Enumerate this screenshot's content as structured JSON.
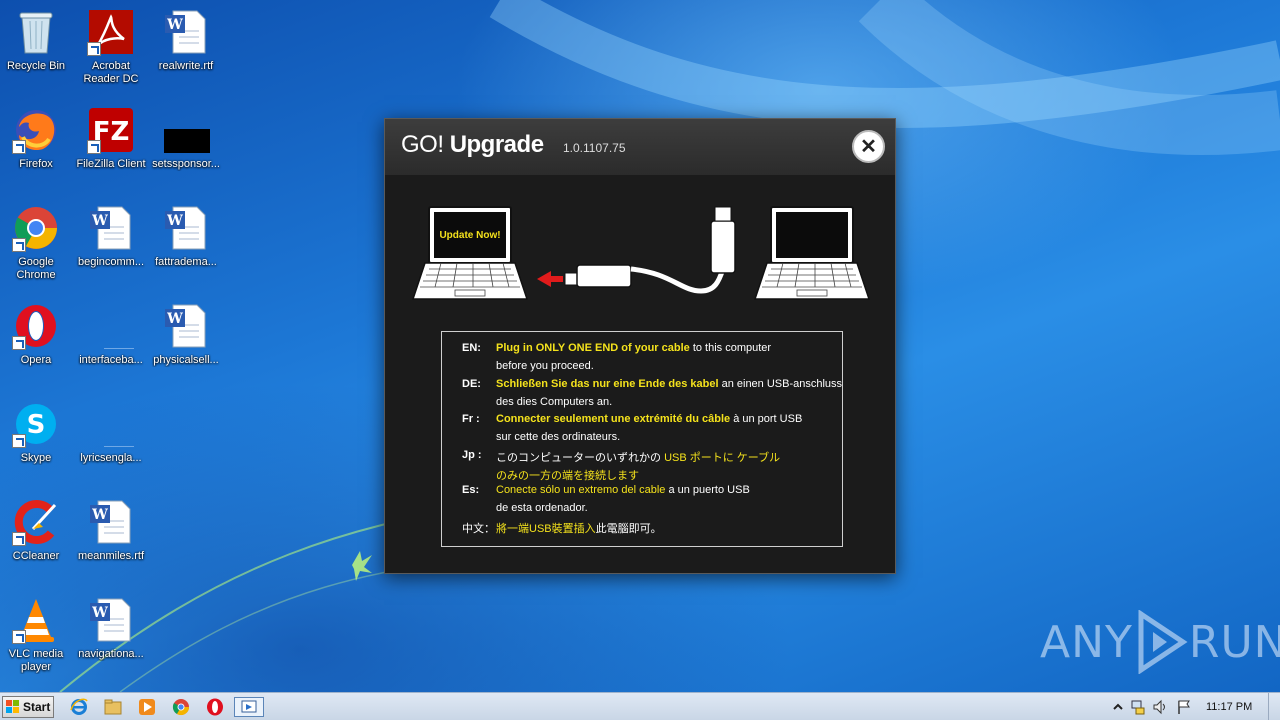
{
  "desktop": {
    "icons": [
      {
        "label": "Recycle Bin",
        "icon": "recycle-bin-icon",
        "shortcut": false
      },
      {
        "label": "Acrobat Reader DC",
        "icon": "acrobat-reader-icon",
        "shortcut": true
      },
      {
        "label": "realwrite.rtf",
        "icon": "word-document-icon",
        "shortcut": false
      },
      {
        "label": "Firefox",
        "icon": "firefox-icon",
        "shortcut": true
      },
      {
        "label": "FileZilla Client",
        "icon": "filezilla-icon",
        "shortcut": true
      },
      {
        "label": "setssponsor...",
        "icon": "black-file-icon",
        "shortcut": false
      },
      {
        "label": "Google Chrome",
        "icon": "chrome-icon",
        "shortcut": true
      },
      {
        "label": "begincomm...",
        "icon": "word-document-icon",
        "shortcut": false
      },
      {
        "label": "fattradema...",
        "icon": "word-document-icon",
        "shortcut": false
      },
      {
        "label": "Opera",
        "icon": "opera-icon",
        "shortcut": true
      },
      {
        "label": "interfaceba...",
        "icon": "blank-file-icon",
        "shortcut": false
      },
      {
        "label": "physicalsell...",
        "icon": "word-document-icon",
        "shortcut": false
      },
      {
        "label": "Skype",
        "icon": "skype-icon",
        "shortcut": true
      },
      {
        "label": "lyricsengla...",
        "icon": "blank-file-icon",
        "shortcut": false
      },
      {
        "label": "CCleaner",
        "icon": "ccleaner-icon",
        "shortcut": true
      },
      {
        "label": "meanmiles.rtf",
        "icon": "word-document-icon",
        "shortcut": false
      },
      {
        "label": "VLC media player",
        "icon": "vlc-icon",
        "shortcut": true
      },
      {
        "label": "navigationa...",
        "icon": "word-document-icon",
        "shortcut": false
      }
    ]
  },
  "dialog": {
    "title_light": "GO!",
    "title_bold": "Upgrade",
    "version": "1.0.1107.75",
    "close_label": "✕",
    "screen_text": "Update Now!",
    "instructions": [
      {
        "code": "EN:",
        "line1_hl": "Plug in ONLY ONE END of your cable",
        "line1_rest": " to this computer",
        "line2": "before you proceed."
      },
      {
        "code": "DE:",
        "line1_hl": "Schließen Sie das nur eine Ende des kabel",
        "line1_rest": " an einen USB-anschluss",
        "line2": "des dies Computers an."
      },
      {
        "code": "Fr :",
        "line1_hl": "Connecter seulement une extrémité du câble",
        "line1_rest": " à un port USB",
        "line2": "sur cette des ordinateurs."
      },
      {
        "code": "Jp :",
        "line1_pre": "このコンピューターのいずれかの ",
        "line1_hl": "USB ポートに ケーブル",
        "line2_hl": "のみの一方の端を接続します"
      },
      {
        "code": "Es:",
        "line1_hl": "Conecte sólo un extremo del cable",
        "line1_rest": " a un puerto USB",
        "line2": "de esta ordenador."
      },
      {
        "code": "中文：",
        "line1_hl": "將一端USB裝置插入",
        "line1_rest": "此電腦即可。"
      }
    ]
  },
  "watermark": {
    "left": "ANY",
    "right": "RUN"
  },
  "taskbar": {
    "start_label": "Start",
    "clock": "11:17 PM",
    "pinned": [
      "internet-explorer-icon",
      "explorer-folder-icon",
      "media-player-icon",
      "chrome-icon",
      "opera-icon",
      "go-upgrade-app-icon"
    ],
    "tray": [
      "show-hidden-icons-chevron",
      "network-icon",
      "volume-icon",
      "action-center-flag-icon"
    ]
  },
  "colors": {
    "highlight": "#f4e21c",
    "dialog_bg": "#1b1b1b",
    "desktop_blue": "#1d78d6"
  }
}
